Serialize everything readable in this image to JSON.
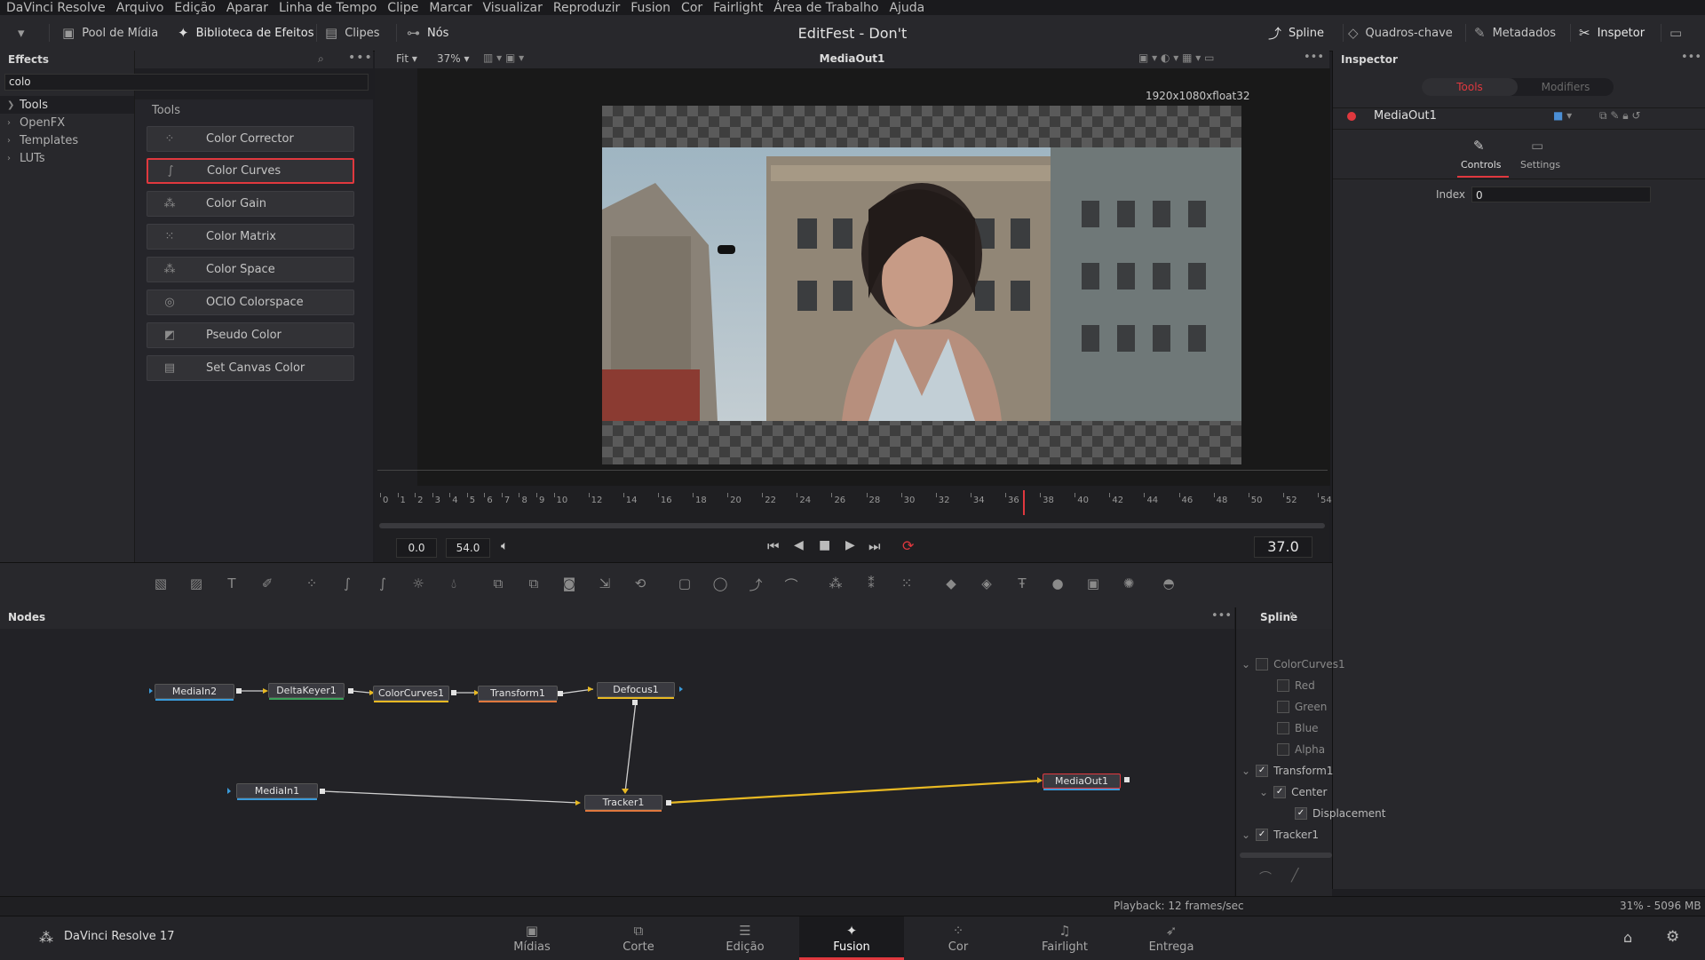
{
  "menu": [
    "DaVinci Resolve",
    "Arquivo",
    "Edição",
    "Aparar",
    "Linha de Tempo",
    "Clipe",
    "Marcar",
    "Visualizar",
    "Reproduzir",
    "Fusion",
    "Cor",
    "Fairlight",
    "Área de Trabalho",
    "Ajuda"
  ],
  "toolbar": {
    "media_pool": "Pool de Mídia",
    "effects_library": "Biblioteca de Efeitos",
    "clips": "Clipes",
    "nodes": "Nós",
    "spline": "Spline",
    "keyframes": "Quadros-chave",
    "metadata": "Metadados",
    "inspector": "Inspetor"
  },
  "project_title": "EditFest - Don't",
  "effects": {
    "header": "Effects",
    "search_value": "colo",
    "tree": [
      "Tools",
      "OpenFX",
      "Templates",
      "LUTs"
    ],
    "list_header": "Tools",
    "items": [
      "Color Corrector",
      "Color Curves",
      "Color Gain",
      "Color Matrix",
      "Color Space",
      "OCIO Colorspace",
      "Pseudo Color",
      "Set Canvas Color"
    ],
    "selected_index": 1
  },
  "viewer": {
    "fit": "Fit",
    "zoom": "37%",
    "node_name": "MediaOut1",
    "resolution": "1920x1080xfloat32",
    "ruler_ticks": [
      "0",
      "1",
      "2",
      "3",
      "4",
      "5",
      "6",
      "7",
      "8",
      "9",
      "10",
      "12",
      "14",
      "16",
      "18",
      "20",
      "22",
      "24",
      "26",
      "28",
      "30",
      "32",
      "34",
      "36",
      "38",
      "40",
      "42",
      "44",
      "46",
      "48",
      "50",
      "52",
      "54"
    ],
    "start": "0.0",
    "end": "54.0",
    "current": "37.0",
    "playhead_frame": 37
  },
  "inspector": {
    "header": "Inspector",
    "tab_tools": "Tools",
    "tab_modifiers": "Modifiers",
    "node_name": "MediaOut1",
    "sub_controls": "Controls",
    "sub_settings": "Settings",
    "index_label": "Index",
    "index_value": "0"
  },
  "nodes": {
    "header": "Nodes",
    "items": [
      "MediaIn2",
      "DeltaKeyer1",
      "ColorCurves1",
      "Transform1",
      "Defocus1",
      "MediaIn1",
      "Tracker1",
      "MediaOut1"
    ]
  },
  "spline": {
    "header": "Spline",
    "rows": [
      "ColorCurves1",
      "Red",
      "Green",
      "Blue",
      "Alpha",
      "Transform1",
      "Center",
      "Displacement",
      "Tracker1"
    ]
  },
  "status": {
    "playback": "Playback: 12 frames/sec",
    "memory": "31% - 5096 MB"
  },
  "pages": [
    "Mídias",
    "Corte",
    "Edição",
    "Fusion",
    "Cor",
    "Fairlight",
    "Entrega"
  ],
  "active_page": "Fusion",
  "app_name": "DaVinci Resolve 17",
  "colors": {
    "accent": "#e0383e",
    "link_line": "#e8b923"
  }
}
